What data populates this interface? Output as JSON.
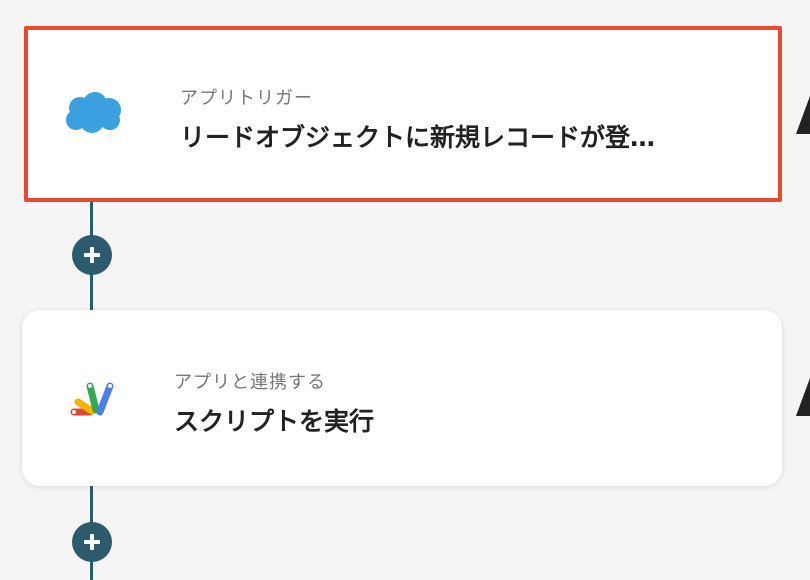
{
  "steps": [
    {
      "kind": "アプリトリガー",
      "title": "リードオブジェクトに新規レコードが登…",
      "icon": "salesforce-cloud-icon",
      "selected": true
    },
    {
      "kind": "アプリと連携する",
      "title": "スクリプトを実行",
      "icon": "google-apps-script-icon",
      "selected": false
    }
  ],
  "colors": {
    "accent": "#2d5b6e",
    "selection": "#e84a2f",
    "salesforce": "#3aa0e0"
  },
  "icons": {
    "add": "plus-icon",
    "warning": "warning-icon"
  }
}
